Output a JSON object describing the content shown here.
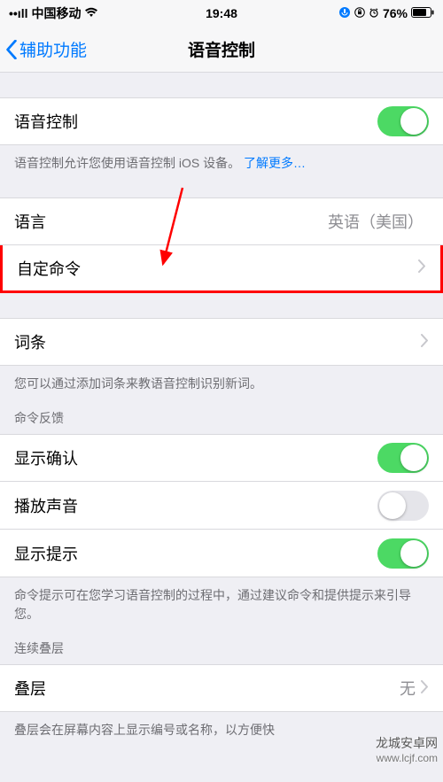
{
  "statusbar": {
    "signal": "••ıll",
    "carrier": "中国移动",
    "time": "19:48",
    "battery_pct": "76%"
  },
  "nav": {
    "back": "辅助功能",
    "title": "语音控制"
  },
  "voice_control": {
    "label": "语音控制",
    "footer_pre": "语音控制允许您使用语音控制 iOS 设备。",
    "footer_link": "了解更多…"
  },
  "rows": {
    "language_label": "语言",
    "language_value": "英语（美国）",
    "custom_cmds": "自定命令",
    "vocabulary": "词条",
    "vocabulary_footer": "您可以通过添加词条来教语音控制识别新词。"
  },
  "feedback": {
    "header": "命令反馈",
    "show_confirm": "显示确认",
    "play_sound": "播放声音",
    "show_hints": "显示提示",
    "footer": "命令提示可在您学习语音控制的过程中，通过建议命令和提供提示来引导您。"
  },
  "overlay": {
    "header": "连续叠层",
    "row": "叠层",
    "value": "无",
    "footer": "叠层会在屏幕内容上显示编号或名称，以方便快"
  },
  "watermark": {
    "line1": "龙城安卓网",
    "line2": "www.lcjf.com"
  }
}
